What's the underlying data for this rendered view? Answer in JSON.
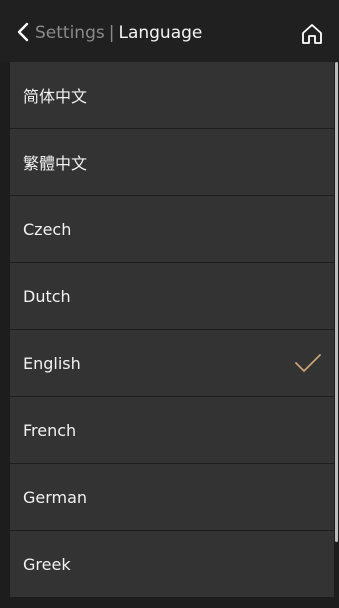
{
  "header": {
    "back_icon": "chevron-left-icon",
    "parent_label": "Settings",
    "separator": "|",
    "title": "Language",
    "home_icon": "home-icon"
  },
  "languages": [
    {
      "label": "简体中文",
      "selected": false
    },
    {
      "label": "繁體中文",
      "selected": false
    },
    {
      "label": "Czech",
      "selected": false
    },
    {
      "label": "Dutch",
      "selected": false
    },
    {
      "label": "English",
      "selected": true
    },
    {
      "label": "French",
      "selected": false
    },
    {
      "label": "German",
      "selected": false
    },
    {
      "label": "Greek",
      "selected": false
    }
  ],
  "colors": {
    "check_accent": "#c8a373",
    "item_background": "#333333",
    "page_background": "#1d1d1d"
  }
}
